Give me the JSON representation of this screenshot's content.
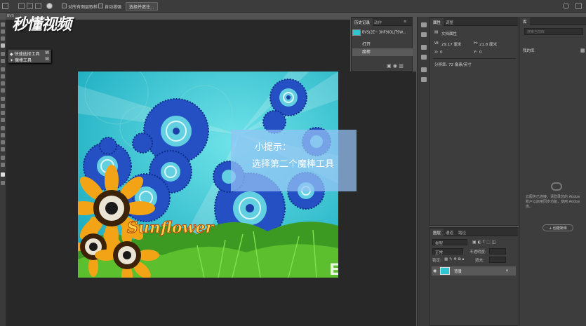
{
  "watermark": "秒懂视频",
  "options_bar": {
    "sample_all_layers": "对所有图层取样",
    "auto_enhance": "自动增强",
    "select_and_mask": "选择并遮住..."
  },
  "document_tab": "BVS",
  "tool_flyout": {
    "items": [
      {
        "label": "快速选择工具",
        "shortcut": "W",
        "icon": "quick-selection-icon"
      },
      {
        "label": "魔棒工具",
        "shortcut": "W",
        "icon": "magic-wand-icon"
      }
    ]
  },
  "canvas": {
    "artwork_text": "Sunflower",
    "corner_text": "E"
  },
  "tip": {
    "line1": "小提示：",
    "line2": "选择第二个魔棒工具"
  },
  "history_panel": {
    "tabs": [
      "历史记录",
      "动作"
    ],
    "snapshot_name": "BVS(2E~ 3HF9IOL]T9W...",
    "items": [
      "打开",
      "魔棒"
    ]
  },
  "properties_panel": {
    "tabs": [
      "属性",
      "调整"
    ],
    "doc_label": "文档属性",
    "w_label": "W:",
    "w_value": "29.17 厘米",
    "h_label": "H:",
    "h_value": "21.8 厘米",
    "x_label": "X:",
    "x_value": "0",
    "y_label": "Y:",
    "y_value": "0",
    "resolution": "分辨率: 72 像素/英寸"
  },
  "library_panel": {
    "tab": "库",
    "search_placeholder": "搜索当前库",
    "category": "我的库",
    "empty_text_1": "云服务已连接。请登录您的 Adobe",
    "empty_text_2": "账户以启用同步功能，使用 Adobe",
    "empty_text_3": "库。",
    "create_button": "+ 创建新库"
  },
  "layers_panel": {
    "tabs": [
      "图层",
      "通道",
      "路径"
    ],
    "kind_label": "类型",
    "blend_mode": "正常",
    "opacity_label": "不透明度:",
    "lock_label": "锁定:",
    "fill_label": "填充:",
    "layer_name": "背景"
  },
  "colors": {
    "canvas_bg": "#2fc5d3",
    "blue_circle": "#2350c8",
    "tip_bg": "#96c3f5"
  }
}
